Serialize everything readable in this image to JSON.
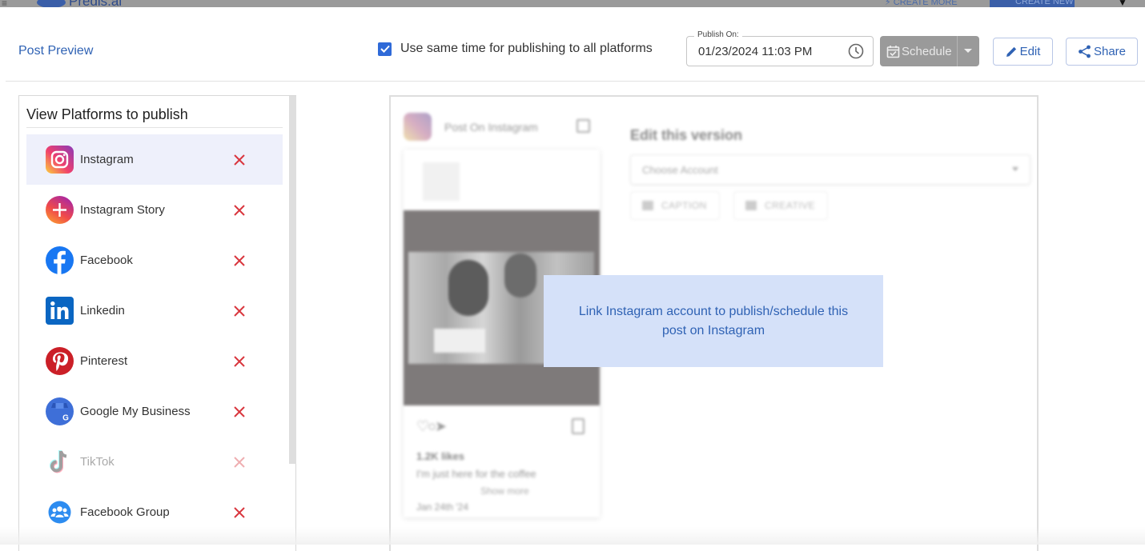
{
  "app_bar": {
    "menu_icon": "hamburger-icon",
    "brand": "Predis.ai",
    "create_more": "CREATE MORE",
    "create_new": "CREATE NEW"
  },
  "header": {
    "title": "Post Preview",
    "same_time_checkbox": {
      "label": "Use same time for publishing to all platforms",
      "checked": true
    },
    "publish_on": {
      "label": "Publish On:",
      "value": "01/23/2024 11:03 PM"
    },
    "schedule_button": "Schedule",
    "edit_button": "Edit",
    "share_button": "Share"
  },
  "platforms_panel": {
    "title": "View Platforms to publish",
    "items": [
      {
        "name": "Instagram",
        "icon": "instagram-icon",
        "active": true,
        "disabled": false
      },
      {
        "name": "Instagram Story",
        "icon": "instagram-story-icon",
        "active": false,
        "disabled": false
      },
      {
        "name": "Facebook",
        "icon": "facebook-icon",
        "active": false,
        "disabled": false
      },
      {
        "name": "Linkedin",
        "icon": "linkedin-icon",
        "active": false,
        "disabled": false
      },
      {
        "name": "Pinterest",
        "icon": "pinterest-icon",
        "active": false,
        "disabled": false
      },
      {
        "name": "Google My Business",
        "icon": "google-my-business-icon",
        "active": false,
        "disabled": false
      },
      {
        "name": "TikTok",
        "icon": "tiktok-icon",
        "active": false,
        "disabled": true
      },
      {
        "name": "Facebook Group",
        "icon": "facebook-group-icon",
        "active": false,
        "disabled": false
      }
    ]
  },
  "preview": {
    "post_title": "Post On Instagram",
    "likes": "1.2K likes",
    "caption": "I'm just here for the coffee",
    "show_more": "Show more",
    "date": "Jan 24th '24",
    "edit_version_title": "Edit this version",
    "choose_account_placeholder": "Choose Account",
    "tabs": [
      "CAPTION",
      "CREATIVE"
    ]
  },
  "notice": {
    "text": "Link Instagram account to publish/schedule this post on Instagram"
  },
  "colors": {
    "accent": "#2f62b4",
    "checkbox": "#2f6ad8",
    "remove": "#d9363e",
    "notice_bg": "#d5e1f9",
    "active_row": "#eef0fb"
  }
}
